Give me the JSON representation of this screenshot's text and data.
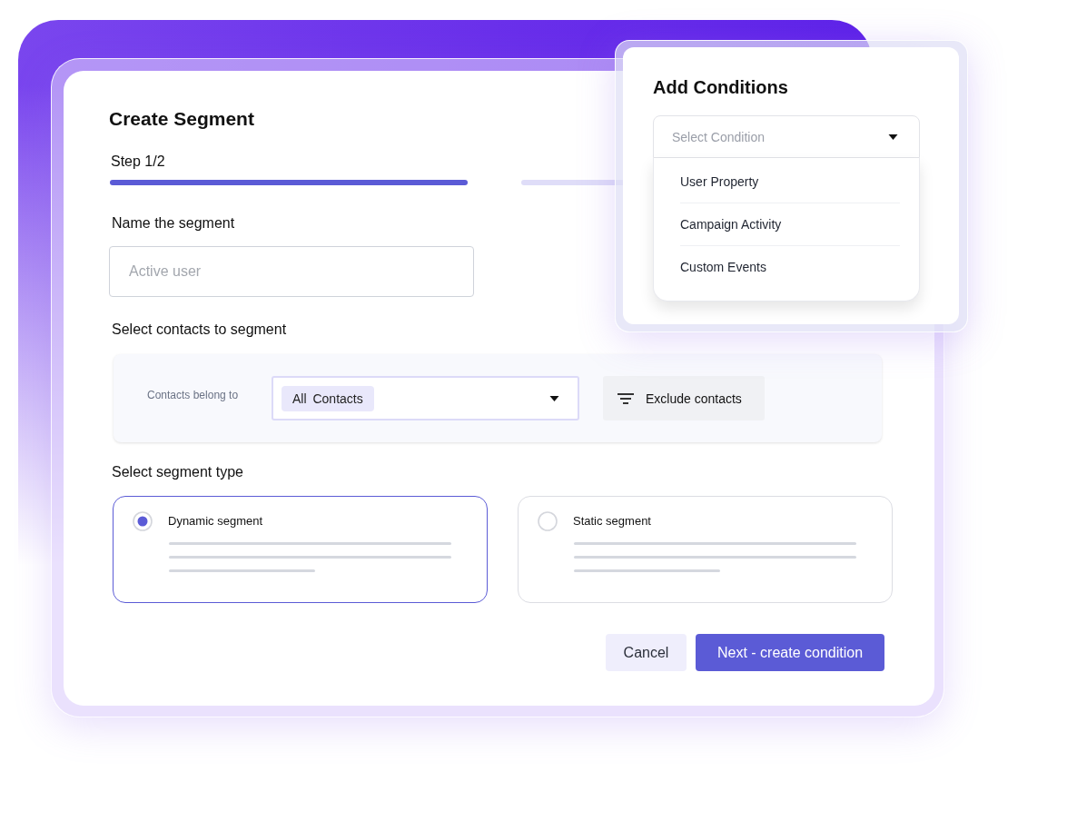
{
  "card": {
    "title": "Create Segment",
    "step_label": "Step 1/2",
    "steps": [
      {
        "complete": true
      },
      {
        "complete": false
      }
    ],
    "name_field": {
      "label": "Name the segment",
      "placeholder": "Active user"
    },
    "contacts": {
      "heading": "Select contacts to segment",
      "label": "Contacts belong to",
      "chip": "All Contacts",
      "exclude_button": "Exclude contacts"
    },
    "segment_type": {
      "heading": "Select segment type",
      "options": [
        {
          "label": "Dynamic segment",
          "selected": true
        },
        {
          "label": "Static segment",
          "selected": false
        }
      ]
    },
    "buttons": [
      {
        "label": "Cancel",
        "kind": "secondary"
      },
      {
        "label": "Next - create condition",
        "kind": "primary"
      }
    ]
  },
  "conditions_popup": {
    "title": "Add Conditions",
    "select": {
      "placeholder": "Select Condition",
      "expanded": true
    },
    "options": [
      "User Property",
      "Campaign Activity",
      "Custom Events"
    ]
  }
}
